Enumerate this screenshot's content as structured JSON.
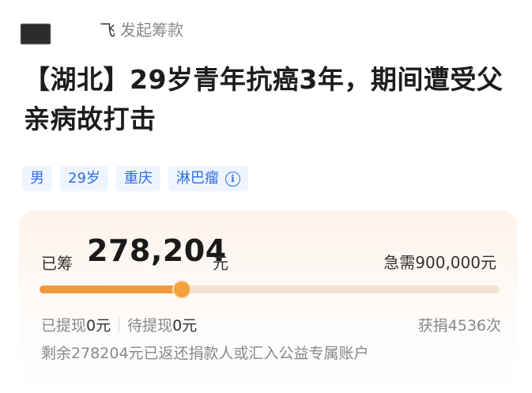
{
  "organizer": {
    "name": "飞",
    "action": "发起筹款"
  },
  "title": "【湖北】29岁青年抗癌3年，期间遭受父亲病故打击",
  "tags": [
    "男",
    "29岁",
    "重庆",
    "淋巴瘤"
  ],
  "fundraising": {
    "raised_label": "已筹",
    "raised_amount": "278,204",
    "raised_unit": "元",
    "target_text": "急需900,000元",
    "progress_fraction": 0.309,
    "withdrawn_label": "已提现",
    "withdrawn_value": "0元",
    "pending_label": "待提现",
    "pending_value": "0元",
    "donations_text": "获捐4536次",
    "note": "剩余278204元已返还捐款人或汇入公益专属账户"
  },
  "colors": {
    "accent_orange": "#f3a13a",
    "tag_blue": "#2f6fe0",
    "tag_bg": "#eef5ff"
  },
  "icons": {
    "tag_info": "info-icon"
  }
}
